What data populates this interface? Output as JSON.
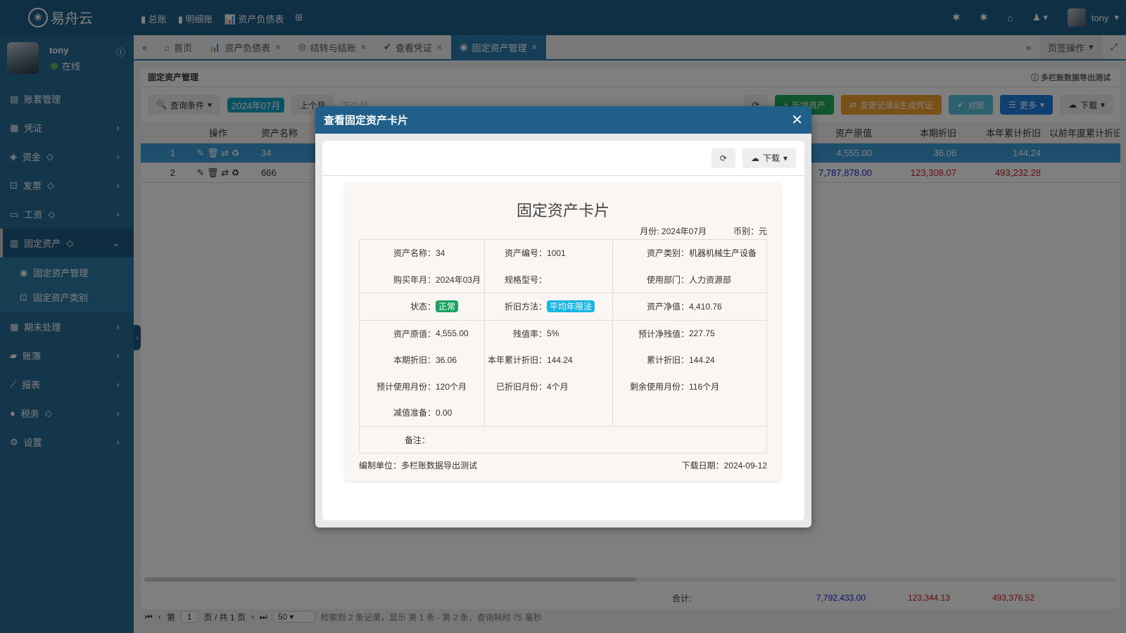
{
  "app": {
    "logo": "易舟云",
    "quick_links": [
      "总账",
      "明细账",
      "资产负债表"
    ],
    "user": "tony"
  },
  "sidebar": {
    "user": {
      "name": "tony",
      "status": "在线"
    },
    "items": [
      {
        "label": "账套管理",
        "icon": "archive-icon",
        "gem": false,
        "chev": false
      },
      {
        "label": "凭证",
        "icon": "voucher-icon",
        "gem": false,
        "chev": true
      },
      {
        "label": "资金",
        "icon": "money-icon",
        "gem": true,
        "chev": true
      },
      {
        "label": "发票",
        "icon": "invoice-icon",
        "gem": true,
        "chev": true
      },
      {
        "label": "工资",
        "icon": "card-icon",
        "gem": true,
        "chev": true
      },
      {
        "label": "固定资产",
        "icon": "building-icon",
        "gem": true,
        "chev": true,
        "active": true
      },
      {
        "label": "期末处理",
        "icon": "calendar-icon",
        "gem": false,
        "chev": true
      },
      {
        "label": "账簿",
        "icon": "book-icon",
        "gem": false,
        "chev": true
      },
      {
        "label": "报表",
        "icon": "chart-icon",
        "gem": false,
        "chev": true
      },
      {
        "label": "税务",
        "icon": "tax-icon",
        "gem": true,
        "chev": true
      },
      {
        "label": "设置",
        "icon": "gear-icon",
        "gem": false,
        "chev": true
      }
    ],
    "sub_items": [
      "固定资产管理",
      "固定资产类别"
    ]
  },
  "tabs": [
    {
      "label": "首页",
      "closable": false
    },
    {
      "label": "资产负债表",
      "closable": true
    },
    {
      "label": "结转与结账",
      "closable": true
    },
    {
      "label": "查看凭证",
      "closable": true
    },
    {
      "label": "固定资产管理",
      "closable": true,
      "active": true
    }
  ],
  "tab_ops": "页签操作",
  "page": {
    "title": "固定资产管理",
    "company": "多栏账数据导出测试",
    "toolbar": {
      "query": "查询条件",
      "period": "2024年07月",
      "prev": "上个月",
      "next": "下个月",
      "add": "新增资产",
      "change": "变更记录&生成凭证",
      "reconcile": "对账",
      "more": "更多",
      "download": "下载"
    },
    "columns": [
      "",
      "操作",
      "资产名称",
      "资产原值",
      "本期折旧",
      "本年累计折旧",
      "以前年度累计折旧"
    ],
    "rows": [
      {
        "no": "1",
        "name": "34",
        "original": "4,555.00",
        "period_dep": "36.06",
        "year_dep": "144.24",
        "prior_dep": ""
      },
      {
        "no": "2",
        "name": "666",
        "original": "7,787,878.00",
        "period_dep": "123,308.07",
        "year_dep": "493,232.28",
        "prior_dep": ""
      }
    ],
    "total": {
      "label": "合计:",
      "original": "7,792,433.00",
      "period_dep": "123,344.13",
      "year_dep": "493,376.52"
    },
    "pager": {
      "page_prefix": "第",
      "page": "1",
      "page_suffix": "页 / 共 1 页",
      "page_size": "50",
      "summary": "检索到 2 条记录，显示 第 1 条 - 第 2 条，查询耗时 75 毫秒"
    }
  },
  "modal": {
    "title": "查看固定资产卡片",
    "download": "下载",
    "card": {
      "title": "固定资产卡片",
      "month": "月份: 2024年07月",
      "currency": "币别：元",
      "col1": [
        [
          "资产名称：",
          "34"
        ],
        [
          "购买年月：",
          "2024年03月"
        ],
        [
          "状态：",
          "正常"
        ],
        [
          "资产原值：",
          "4,555.00"
        ],
        [
          "本期折旧：",
          "36.06"
        ],
        [
          "预计使用月份：",
          "120个月"
        ],
        [
          "减值准备：",
          "0.00"
        ]
      ],
      "col2": [
        [
          "资产编号：",
          "1001"
        ],
        [
          "规格型号：",
          ""
        ],
        [
          "折旧方法：",
          "平均年限法"
        ],
        [
          "残值率：",
          "5%"
        ],
        [
          "本年累计折旧：",
          "144.24"
        ],
        [
          "已折旧月份：",
          "4个月"
        ]
      ],
      "col3": [
        [
          "资产类别：",
          "机器机械生产设备"
        ],
        [
          "使用部门：",
          "人力资源部"
        ],
        [
          "资产净值：",
          "4,410.76"
        ],
        [
          "预计净残值：",
          "227.75"
        ],
        [
          "累计折旧：",
          "144.24"
        ],
        [
          "剩余使用月份：",
          "116个月"
        ]
      ],
      "remark": "备注：",
      "unit": "编制单位：多栏账数据导出测试",
      "date": "下载日期：2024-09-12"
    },
    "colors": {
      "status_tag": "#1aa260",
      "method_tag": "#17b6e6",
      "header": "#1f5f8a"
    }
  }
}
